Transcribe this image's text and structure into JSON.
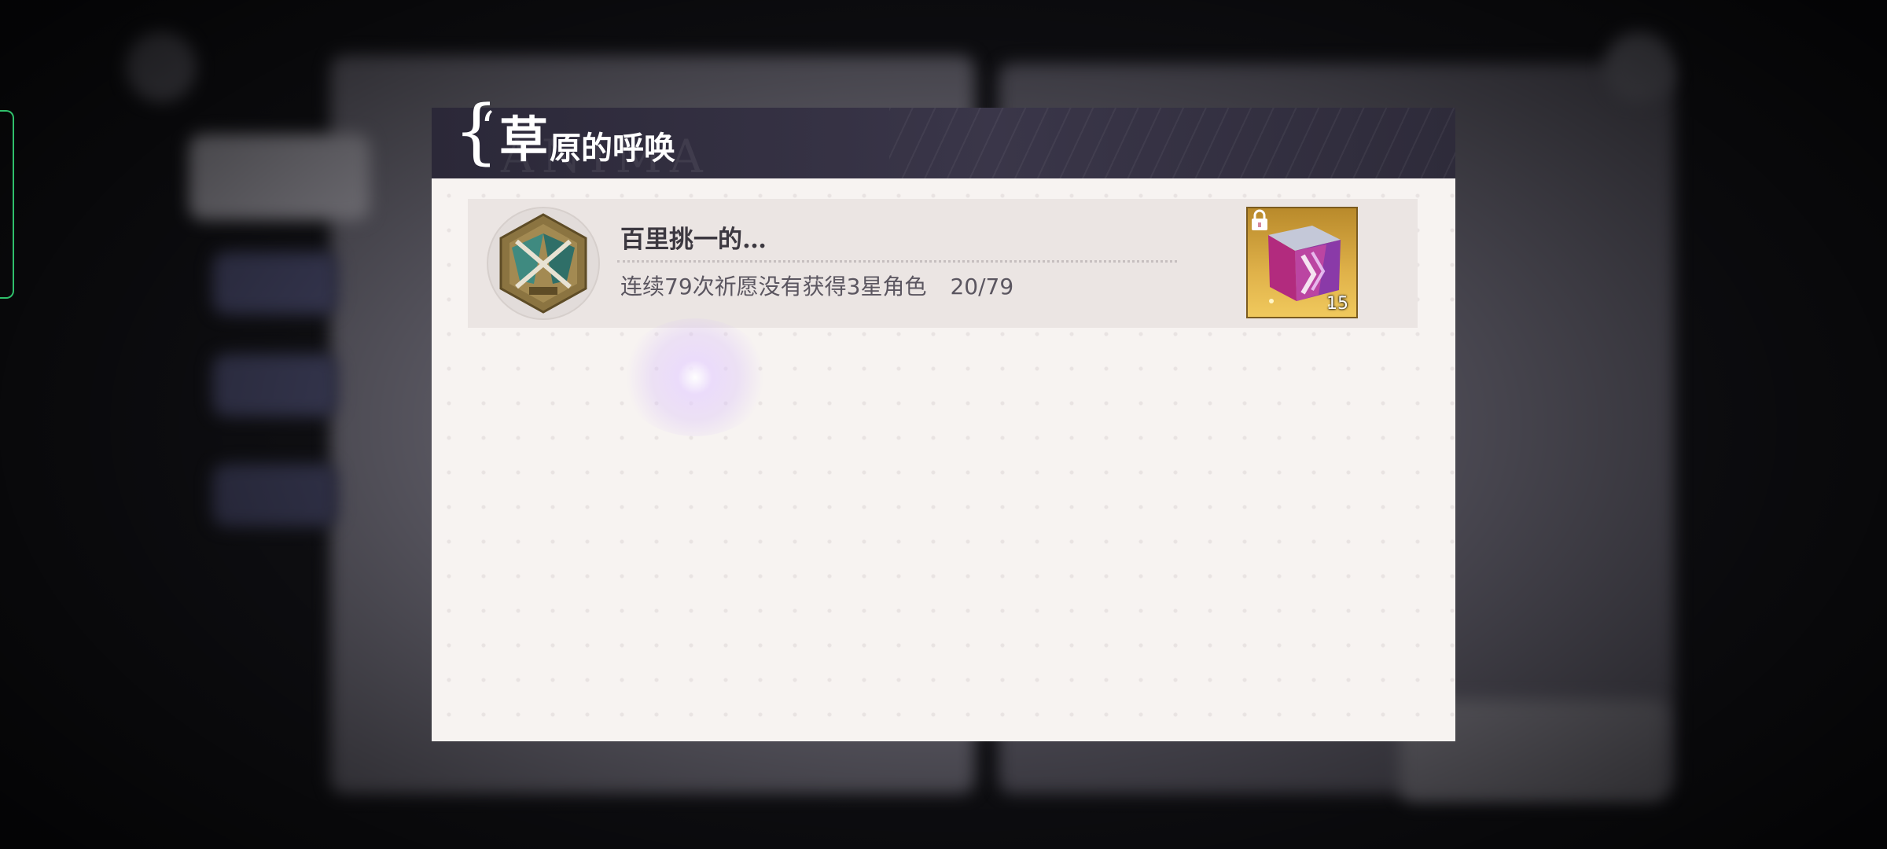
{
  "dialog": {
    "title_first_char": "草",
    "title_rest": "原的呼唤",
    "watermark": "ANIMA"
  },
  "achievements": [
    {
      "title": "百里挑一的…",
      "description": "连续79次祈愿没有获得3星角色",
      "progress": "20/79",
      "progress_current": 20,
      "progress_total": 79,
      "icon": "crossed-swords-badge-icon",
      "reward": {
        "icon": "prism-cube-icon",
        "count": "15",
        "locked": true
      }
    }
  ],
  "colors": {
    "header_bg": "#2b2838",
    "body_bg": "#f7f3f1",
    "row_bg": "#ebe5e3",
    "reward_gold": "#e0b24a",
    "side_marker": "#2fbf6b"
  }
}
